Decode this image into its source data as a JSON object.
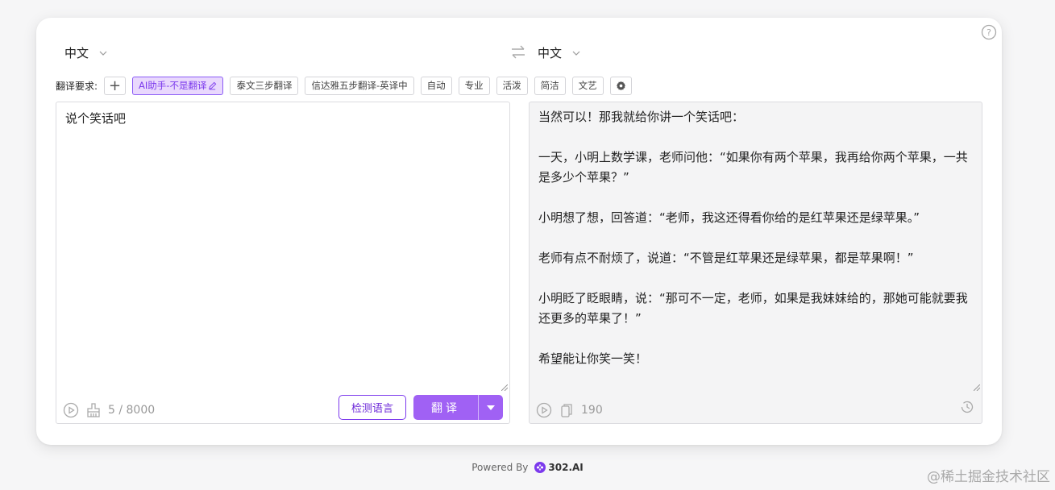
{
  "source_lang": "中文",
  "target_lang": "中文",
  "requirements": {
    "label": "翻译要求:",
    "add": "+",
    "tags": [
      "AI助手-不是翻译",
      "泰文三步翻译",
      "信达雅五步翻译-英译中",
      "自动",
      "专业",
      "活泼",
      "简洁",
      "文艺"
    ]
  },
  "source": {
    "text": "说个笑话吧",
    "char_count": "5 / 8000",
    "detect_label": "检测语言",
    "translate_label": "翻译"
  },
  "output": {
    "lines": [
      "当然可以！那我就给你讲一个笑话吧：",
      "",
      "一天，小明上数学课，老师问他：“如果你有两个苹果，我再给你两个苹果，一共是多少个苹果？”",
      "",
      "小明想了想，回答道：“老师，我这还得看你给的是红苹果还是绿苹果。”",
      "",
      "老师有点不耐烦了，说道：“不管是红苹果还是绿苹果，都是苹果啊！”",
      "",
      "小明眨了眨眼睛，说：“那可不一定，老师，如果是我妹妹给的，那她可能就要我还更多的苹果了！”",
      "",
      "希望能让你笑一笑！"
    ],
    "char_count": "190"
  },
  "footer": {
    "powered_by": "Powered By",
    "brand": "302.AI"
  },
  "watermark": "@稀土掘金技术社区",
  "colors": {
    "accent": "#a061f4",
    "active_tag_bg": "#e9d8fd"
  }
}
